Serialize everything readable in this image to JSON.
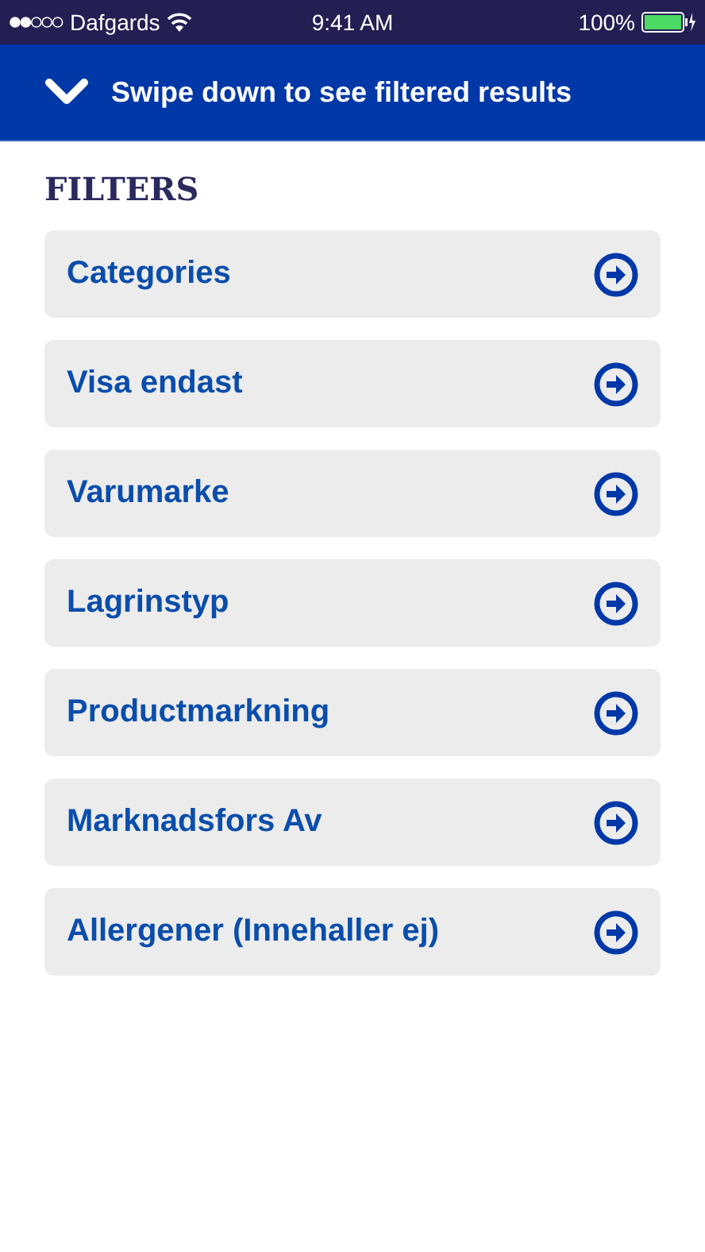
{
  "status_bar": {
    "carrier": "Dafgards",
    "time": "9:41 AM",
    "battery": "100%"
  },
  "banner": {
    "text": "Swipe down to see filtered results"
  },
  "filters": {
    "title": "FILTERS",
    "items": [
      {
        "label": "Categories"
      },
      {
        "label": "Visa endast"
      },
      {
        "label": "Varumarke"
      },
      {
        "label": "Lagrinstyp"
      },
      {
        "label": "Productmarkning"
      },
      {
        "label": "Marknadsfors Av"
      },
      {
        "label": "Allergener (Innehaller ej)"
      }
    ]
  }
}
